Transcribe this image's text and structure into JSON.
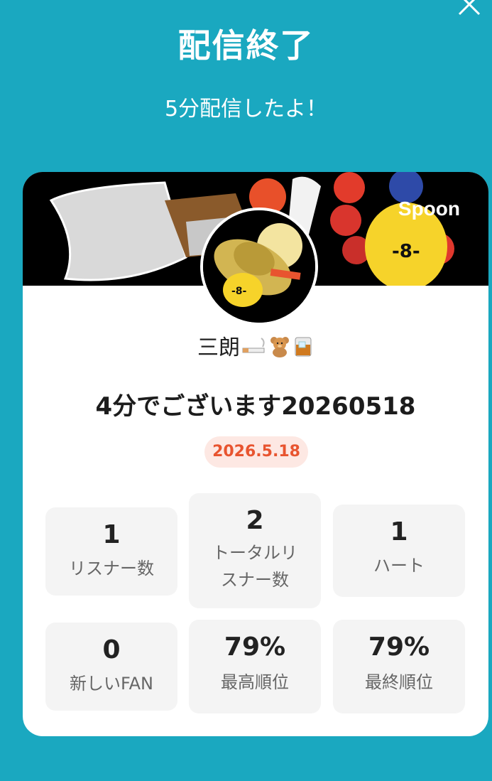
{
  "header": {
    "title": "配信終了",
    "subtitle": "5分配信したよ！"
  },
  "card": {
    "brand": "Spoon",
    "nickname": "三朗",
    "nickname_emojis": [
      "cigarette-emoji",
      "teddy-bear-emoji",
      "whisky-glass-emoji"
    ],
    "live_title": "4分でございます20260518",
    "date": "2026.5.18"
  },
  "stats": [
    {
      "value": "1",
      "label": "リスナー数"
    },
    {
      "value": "2",
      "label_line1": "トータルリ",
      "label_line2": "スナー数"
    },
    {
      "value": "1",
      "label": "ハート"
    },
    {
      "value": "0",
      "label": "新しいFAN"
    },
    {
      "value": "79%",
      "label": "最高順位"
    },
    {
      "value": "79%",
      "label": "最終順位"
    }
  ],
  "colors": {
    "background": "#1aa8c0",
    "card": "#ffffff",
    "date_badge_bg": "#fde8e3",
    "date_badge_text": "#e8542f",
    "stat_bg": "#f4f4f4"
  }
}
